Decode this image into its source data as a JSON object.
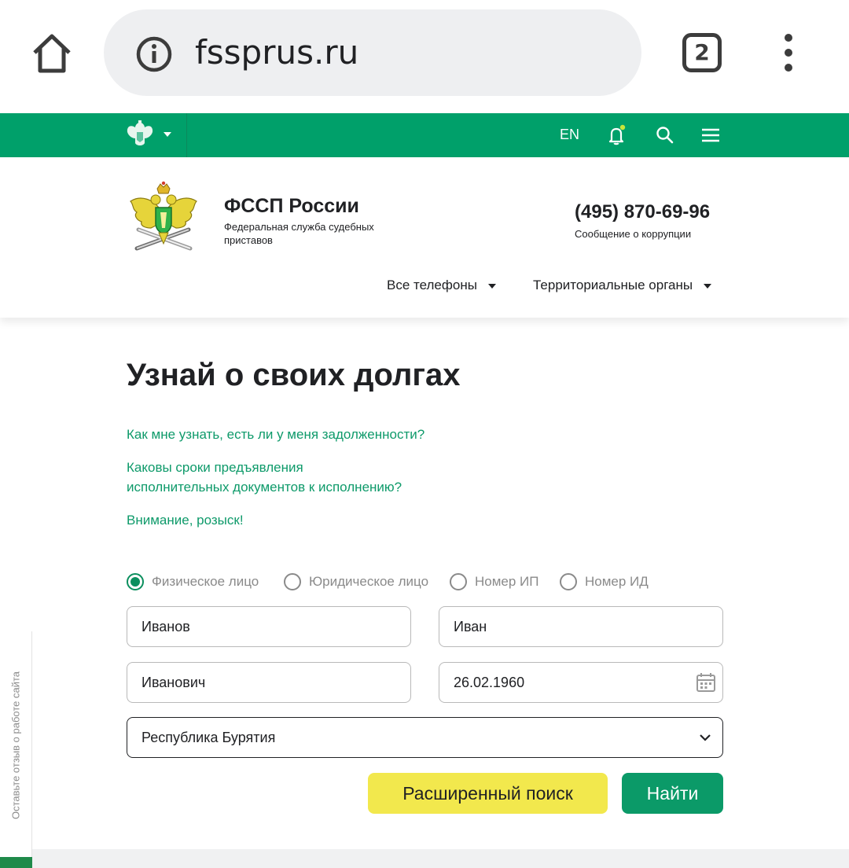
{
  "browser": {
    "url": "fssprus.ru",
    "tab_count": "2",
    "icons": [
      "home-icon",
      "info-icon",
      "tabs-icon",
      "menu-dots-icon"
    ]
  },
  "topbar": {
    "lang": "EN",
    "icons": [
      "emblem-icon",
      "bell-icon",
      "search-icon",
      "menu-icon"
    ],
    "bg_color": "#00a06a",
    "notification_dot_color": "#c8e63a"
  },
  "header": {
    "org_name": "ФССП России",
    "org_subtitle": "Федеральная служба судебных приставов",
    "phone": "(495) 870-69-96",
    "phone_note": "Сообщение о коррупции",
    "nav": [
      "Все телефоны",
      "Территориальные органы"
    ]
  },
  "main": {
    "title": "Узнай о своих долгах",
    "links": [
      "Как мне узнать, есть ли у меня задолженности?",
      "Каковы сроки предъявления исполнительных документов к исполнению?",
      "Внимание, розыск!"
    ],
    "link_line2": "исполнительных документов к исполнению?",
    "link_line1": "Каковы сроки предъявления",
    "search_type": {
      "options": [
        "Физическое лицо",
        "Юридическое лицо",
        "Номер ИП",
        "Номер ИД"
      ],
      "selected": "Физическое лицо"
    },
    "form": {
      "last_name": "Иванов",
      "first_name": "Иван",
      "patronymic": "Иванович",
      "birth_date": "26.02.1960",
      "region": "Республика Бурятия"
    },
    "buttons": {
      "advanced": "Расширенный поиск",
      "find": "Найти"
    }
  },
  "feedback": {
    "label": "Оставьте отзыв о работе сайта"
  },
  "colors": {
    "accent_green": "#0b9a68",
    "link_green": "#0e9a6a",
    "yellow": "#f2e84d"
  }
}
